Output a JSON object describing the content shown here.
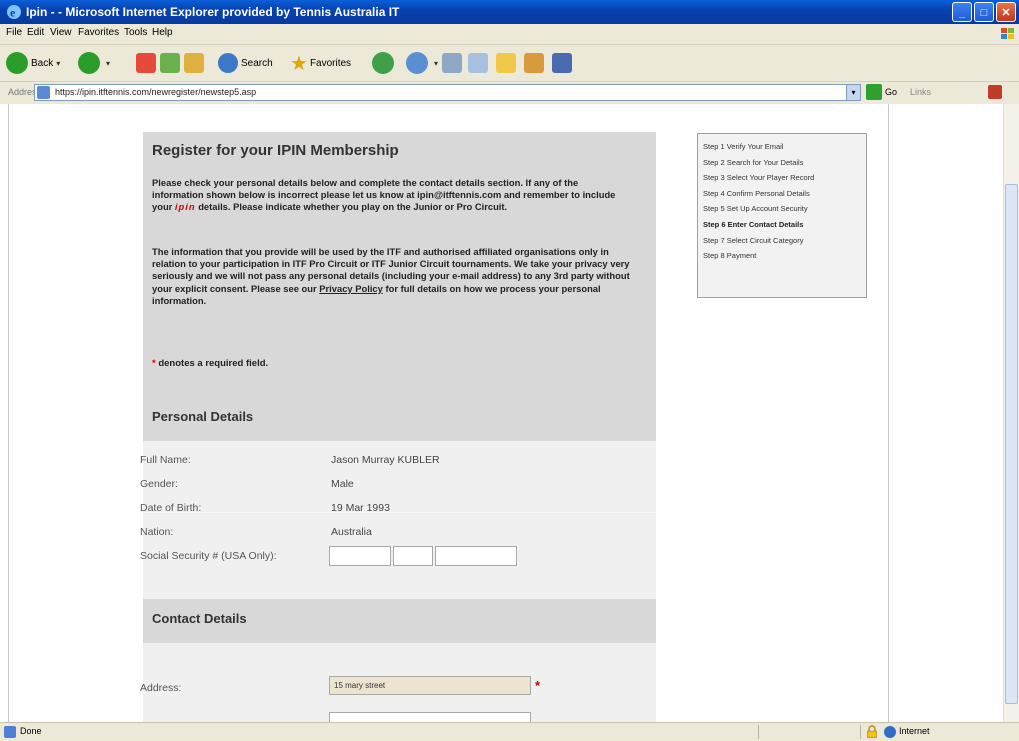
{
  "window": {
    "title": "Ipin - - Microsoft Internet Explorer provided by Tennis Australia IT",
    "minimize_label": "_",
    "maximize_label": "□",
    "close_label": "✕"
  },
  "menu": [
    "File",
    "Edit",
    "View",
    "Favorites",
    "Tools",
    "Help"
  ],
  "toolbar": {
    "back_label": "Back",
    "search_label": "Search",
    "favorites_label": "Favorites"
  },
  "address_bar": {
    "label": "Address",
    "url": "https://ipin.itftennis.com/newregister/newstep5.asp",
    "go_label": "Go",
    "links_label": "Links"
  },
  "page": {
    "heading": "Register for your IPIN Membership",
    "intro_p1_before": "Please check your personal details below and complete the contact details section. If any of the information shown below is incorrect please let us know at ipin@itftennis.com and remember to include your ",
    "intro_ipin_word": "ipin",
    "intro_p1_after": " details. Please indicate whether you play on the Junior or Pro Circuit.",
    "intro_p2_before": "The information that you provide will be used by the ITF and authorised affiliated organisations only in relation to your participation in ITF Pro Circuit or ITF Junior Circuit tournaments. We take your privacy very seriously and we will not pass any personal details (including your e-mail address) to any 3rd party without your explicit consent. Please see our ",
    "privacy_link": "Privacy Policy",
    "intro_p2_after": " for full details on how we process your personal information.",
    "required_star": "*",
    "required_note": " denotes a required field.",
    "personal_section": "Personal Details",
    "contact_section": "Contact Details",
    "fields": {
      "full_name_label": "Full Name:",
      "full_name_value": "Jason Murray KUBLER",
      "gender_label": "Gender:",
      "gender_value": "Male",
      "dob_label": "Date of Birth:",
      "dob_value": "19 Mar 1993",
      "nation_label": "Nation:",
      "nation_value": "Australia",
      "ssn_label": "Social Security # (USA Only):",
      "address_label": "Address:",
      "address_value": "15 mary street"
    }
  },
  "steps": [
    "Step 1 Verify Your Email",
    "Step 2 Search for Your Details",
    "Step 3 Select Your Player Record",
    "Step 4 Confirm Personal Details",
    "Step 5 Set Up Account Security",
    "Step 6 Enter Contact Details",
    "Step 7 Select Circuit Category",
    "Step 8 Payment"
  ],
  "active_step_index": 5,
  "status_bar": {
    "status": "Done",
    "zone": "Internet"
  },
  "colors": {
    "titlebar": "#0842b0",
    "required": "#d40000",
    "section_bg": "#d8d8d8"
  }
}
